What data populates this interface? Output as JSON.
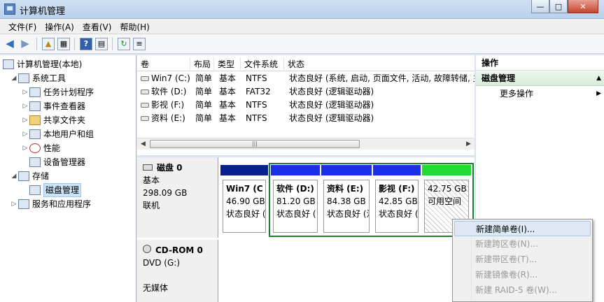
{
  "window": {
    "title": "计算机管理"
  },
  "menu": [
    "文件(F)",
    "操作(A)",
    "查看(V)",
    "帮助(H)"
  ],
  "tree": [
    {
      "label": "计算机管理(本地)",
      "level": 0,
      "expanded": true
    },
    {
      "label": "系统工具",
      "level": 1,
      "expanded": true
    },
    {
      "label": "任务计划程序",
      "level": 2
    },
    {
      "label": "事件查看器",
      "level": 2
    },
    {
      "label": "共享文件夹",
      "level": 2
    },
    {
      "label": "本地用户和组",
      "level": 2
    },
    {
      "label": "性能",
      "level": 2
    },
    {
      "label": "设备管理器",
      "level": 2
    },
    {
      "label": "存储",
      "level": 1,
      "expanded": true
    },
    {
      "label": "磁盘管理",
      "level": 2,
      "selected": true
    },
    {
      "label": "服务和应用程序",
      "level": 1
    }
  ],
  "volumes": {
    "columns": [
      "卷",
      "布局",
      "类型",
      "文件系统",
      "状态"
    ],
    "rows": [
      [
        "Win7 (C:)",
        "简单",
        "基本",
        "NTFS",
        "状态良好 (系统, 启动, 页面文件, 活动, 故障转储, 主"
      ],
      [
        "软件 (D:)",
        "简单",
        "基本",
        "FAT32",
        "状态良好 (逻辑驱动器)"
      ],
      [
        "影视 (F:)",
        "简单",
        "基本",
        "NTFS",
        "状态良好 (逻辑驱动器)"
      ],
      [
        "资料 (E:)",
        "简单",
        "基本",
        "NTFS",
        "状态良好 (逻辑驱动器)"
      ]
    ]
  },
  "disk0": {
    "name": "磁盘 0",
    "type": "基本",
    "size": "298.09 GB",
    "status": "联机",
    "partitions": [
      {
        "name": "Win7  (C",
        "size": "46.90 GB",
        "status": "状态良好 (",
        "color": "#0a1f8f"
      },
      {
        "name": "软件  (D:)",
        "size": "81.20 GB",
        "status": "状态良好 (",
        "color": "#1b2fe6"
      },
      {
        "name": "资料  (E:)",
        "size": "84.38 GB",
        "status": "状态良好 (江",
        "color": "#1b2fe6"
      },
      {
        "name": "影视  (F:)",
        "size": "42.85 GB",
        "status": "状态良好 (",
        "color": "#1b2fe6"
      },
      {
        "name": "",
        "size": "42.75 GB",
        "status": "可用空间",
        "color": "#21d930"
      }
    ]
  },
  "cdrom0": {
    "name": "CD-ROM 0",
    "type": "DVD (G:)",
    "media": "无媒体"
  },
  "actions": {
    "header": "操作",
    "section": "磁盘管理",
    "more": "更多操作"
  },
  "context_menu": [
    {
      "label": "新建简单卷(I)...",
      "enabled": true
    },
    {
      "label": "新建跨区卷(N)...",
      "enabled": false
    },
    {
      "label": "新建带区卷(T)...",
      "enabled": false
    },
    {
      "label": "新建镜像卷(R)...",
      "enabled": false
    },
    {
      "label": "新建 RAID-5 卷(W)...",
      "enabled": false
    }
  ],
  "colors": {
    "primary_partition": "#0a1f8f",
    "logical_drive": "#1b2fe6",
    "free_space": "#21d930",
    "extended_border": "#1d7f2d"
  }
}
